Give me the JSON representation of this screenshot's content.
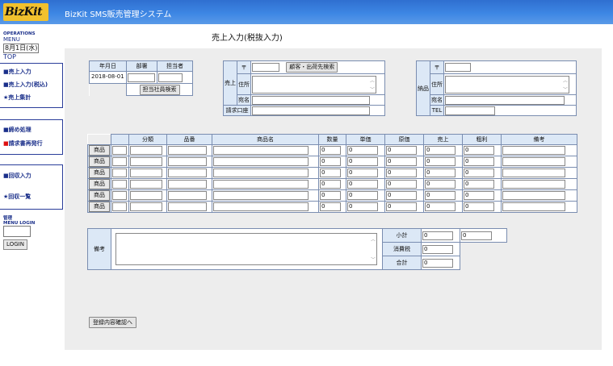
{
  "header": {
    "logo": "BizKit",
    "title": "BizKit SMS販売管理システム"
  },
  "sidebar": {
    "operations": "OPERATIONS",
    "menu": "MENU",
    "date": "8月1日(水)",
    "top": "TOP",
    "group1": [
      "■売上入力",
      "■売上入力(税込)",
      "★売上集計"
    ],
    "group2": [
      "■締め処理",
      "■請求書再発行"
    ],
    "group3": [
      "■回収入力",
      "★回収一覧"
    ],
    "admin": "管理",
    "menu_login": "MENU LOGIN",
    "login_button": "LOGIN"
  },
  "page": {
    "title": "売上入力(税抜入力)"
  },
  "date_block": {
    "col_date": "年月日",
    "col_dept": "部署",
    "col_person": "担当者",
    "date_value": "2018-08-01",
    "search_staff": "担当社員検索"
  },
  "sales_to": {
    "label": "売上",
    "zip_label": "〒",
    "search_button": "顧客・出荷先検索",
    "address_label": "住所",
    "name_label": "宛名",
    "billing_label": "請求口座"
  },
  "ship_to": {
    "label": "納品",
    "zip_label": "〒",
    "address_label": "住所",
    "name_label": "宛名",
    "tel_label": "TEL"
  },
  "items": {
    "headers": [
      "分類",
      "品番",
      "商品名",
      "数量",
      "単価",
      "原価",
      "売上",
      "粗利",
      "備考"
    ],
    "row_button": "商品",
    "rows": [
      {
        "qty": "0",
        "price": "0",
        "cost": "0",
        "sales": "0",
        "profit": "0"
      },
      {
        "qty": "0",
        "price": "0",
        "cost": "0",
        "sales": "0",
        "profit": "0"
      },
      {
        "qty": "0",
        "price": "0",
        "cost": "0",
        "sales": "0",
        "profit": "0"
      },
      {
        "qty": "0",
        "price": "0",
        "cost": "0",
        "sales": "0",
        "profit": "0"
      },
      {
        "qty": "0",
        "price": "0",
        "cost": "0",
        "sales": "0",
        "profit": "0"
      },
      {
        "qty": "0",
        "price": "0",
        "cost": "0",
        "sales": "0",
        "profit": "0"
      }
    ]
  },
  "totals": {
    "remarks_label": "備考",
    "subtotal_label": "小計",
    "tax_label": "消費税",
    "total_label": "合計",
    "subtotal": "0",
    "subtotal_profit": "0",
    "tax": "0",
    "total": "0"
  },
  "footer": {
    "confirm_button": "登録内容確認へ"
  }
}
